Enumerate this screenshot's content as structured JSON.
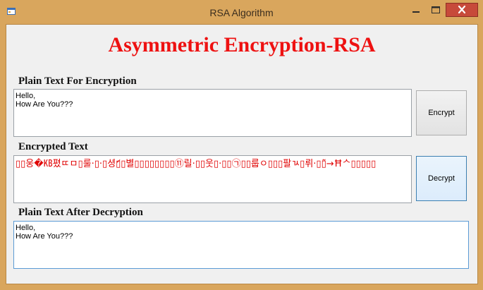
{
  "window": {
    "title": "RSA Algorithm",
    "app_icon": "form-icon",
    "controls": [
      "minimize-icon",
      "maximize-icon",
      "close-icon"
    ],
    "frame_color": "#d9a65d",
    "close_color": "#c74a3a"
  },
  "main": {
    "heading": "Asymmetric Encryption-RSA",
    "heading_color": "#ee1111",
    "plain_label": "Plain Text For Encryption",
    "plain_text": "Hello,\nHow Are You???",
    "encrypt_button": "Encrypt",
    "encrypted_label": "Encrypted Text",
    "encrypted_text": "▯▯웅�㎅폈ㄸㅁ▯룰·▯·▯셩́▯▯별▯▯▯▯▯▯▯▯⑪릴·▯▯웃▯·▯▯㉠▯▯룹ㅇ▯▯▯팔ㄳ▯뤼·▯▯̃→Ħᄉ▯▯▯▯▯",
    "encrypted_color": "#e00000",
    "decrypt_button": "Decrypt",
    "decrypted_label": "Plain Text After Decryption",
    "decrypted_text": "Hello,\nHow Are You???"
  }
}
